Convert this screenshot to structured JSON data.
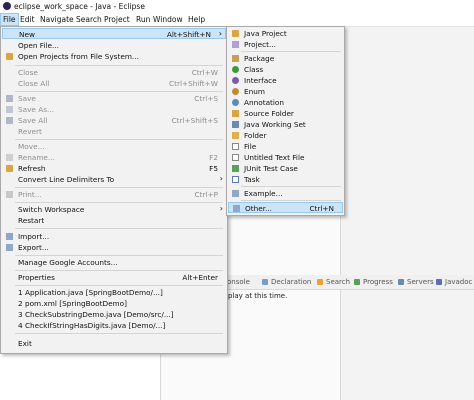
{
  "window": {
    "title": "eclipse_work_space - Java - Eclipse"
  },
  "menubar": [
    "File",
    "Edit",
    "Navigate",
    "Search",
    "Project",
    "Run",
    "Window",
    "Help"
  ],
  "file_menu": {
    "new": {
      "label": "New",
      "shortcut": "Alt+Shift+N"
    },
    "open_file": {
      "label": "Open File..."
    },
    "open_projects": {
      "label": "Open Projects from File System..."
    },
    "close": {
      "label": "Close",
      "shortcut": "Ctrl+W"
    },
    "close_all": {
      "label": "Close All",
      "shortcut": "Ctrl+Shift+W"
    },
    "save": {
      "label": "Save",
      "shortcut": "Ctrl+S"
    },
    "save_as": {
      "label": "Save As..."
    },
    "save_all": {
      "label": "Save All",
      "shortcut": "Ctrl+Shift+S"
    },
    "revert": {
      "label": "Revert"
    },
    "move": {
      "label": "Move..."
    },
    "rename": {
      "label": "Rename...",
      "shortcut": "F2"
    },
    "refresh": {
      "label": "Refresh",
      "shortcut": "F5"
    },
    "convert": {
      "label": "Convert Line Delimiters To"
    },
    "print": {
      "label": "Print...",
      "shortcut": "Ctrl+P"
    },
    "switch_ws": {
      "label": "Switch Workspace"
    },
    "restart": {
      "label": "Restart"
    },
    "import": {
      "label": "Import..."
    },
    "export": {
      "label": "Export..."
    },
    "google": {
      "label": "Manage Google Accounts..."
    },
    "properties": {
      "label": "Properties",
      "shortcut": "Alt+Enter"
    },
    "recent1": {
      "label": "1 Application.java  [SpringBootDemo/...]"
    },
    "recent2": {
      "label": "2 pom.xml  [SpringBootDemo]"
    },
    "recent3": {
      "label": "3 CheckSubstringDemo.java  [Demo/src/...]"
    },
    "recent4": {
      "label": "4 CheckIfStringHasDigits.java  [Demo/...]"
    },
    "exit": {
      "label": "Exit"
    }
  },
  "new_menu": {
    "java_project": "Java Project",
    "project": "Project...",
    "package": "Package",
    "class": "Class",
    "interface": "Interface",
    "enum": "Enum",
    "annotation": "Annotation",
    "source_folder": "Source Folder",
    "working_set": "Java Working Set",
    "folder": "Folder",
    "file": "File",
    "untitled_text": "Untitled Text File",
    "junit": "JUnit Test Case",
    "task": "Task",
    "example": "Example...",
    "other": {
      "label": "Other...",
      "shortcut": "Ctrl+N"
    }
  },
  "bottom_tabs": [
    "onsole",
    "Declaration",
    "Search",
    "Progress",
    "Servers",
    "Javadoc"
  ],
  "console_text": "play at this time.",
  "colors": {
    "highlight": "#cce4f7",
    "highlight_border": "#99c9ef",
    "menu_bg": "#f2f2f2"
  }
}
